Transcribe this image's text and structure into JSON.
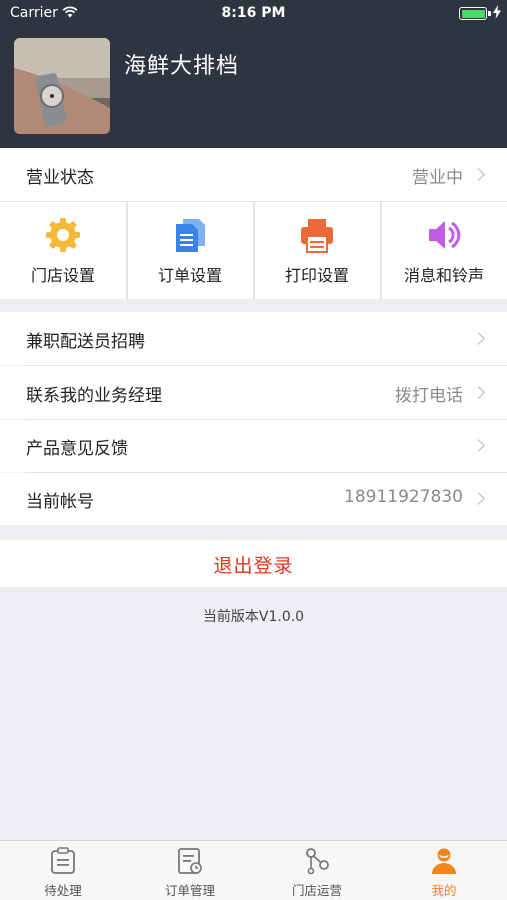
{
  "status_bar": {
    "carrier": "Carrier",
    "time": "8:16 PM"
  },
  "header": {
    "store_name": "海鲜大排档"
  },
  "business_status": {
    "label": "营业状态",
    "value": "营业中"
  },
  "quick_actions": [
    {
      "label": "门店设置",
      "icon": "gear-icon",
      "color": "#f5b83a"
    },
    {
      "label": "订单设置",
      "icon": "document-icon",
      "color": "#3b82e8"
    },
    {
      "label": "打印设置",
      "icon": "printer-icon",
      "color": "#ec6a37"
    },
    {
      "label": "消息和铃声",
      "icon": "speaker-icon",
      "color": "#c05ce6"
    }
  ],
  "menu": [
    {
      "label": "兼职配送员招聘",
      "value": ""
    },
    {
      "label": "联系我的业务经理",
      "value": "拨打电话"
    },
    {
      "label": "产品意见反馈",
      "value": ""
    },
    {
      "label": "当前帐号",
      "value": "18911927830"
    }
  ],
  "logout_label": "退出登录",
  "version": "当前版本V1.0.0",
  "tabbar": [
    {
      "label": "待处理",
      "icon": "clipboard-icon"
    },
    {
      "label": "订单管理",
      "icon": "order-list-icon"
    },
    {
      "label": "门店运营",
      "icon": "network-icon"
    },
    {
      "label": "我的",
      "icon": "user-icon",
      "active": true
    }
  ],
  "colors": {
    "header_bg": "#2c3540",
    "accent": "#f08519",
    "logout": "#e5351e"
  }
}
